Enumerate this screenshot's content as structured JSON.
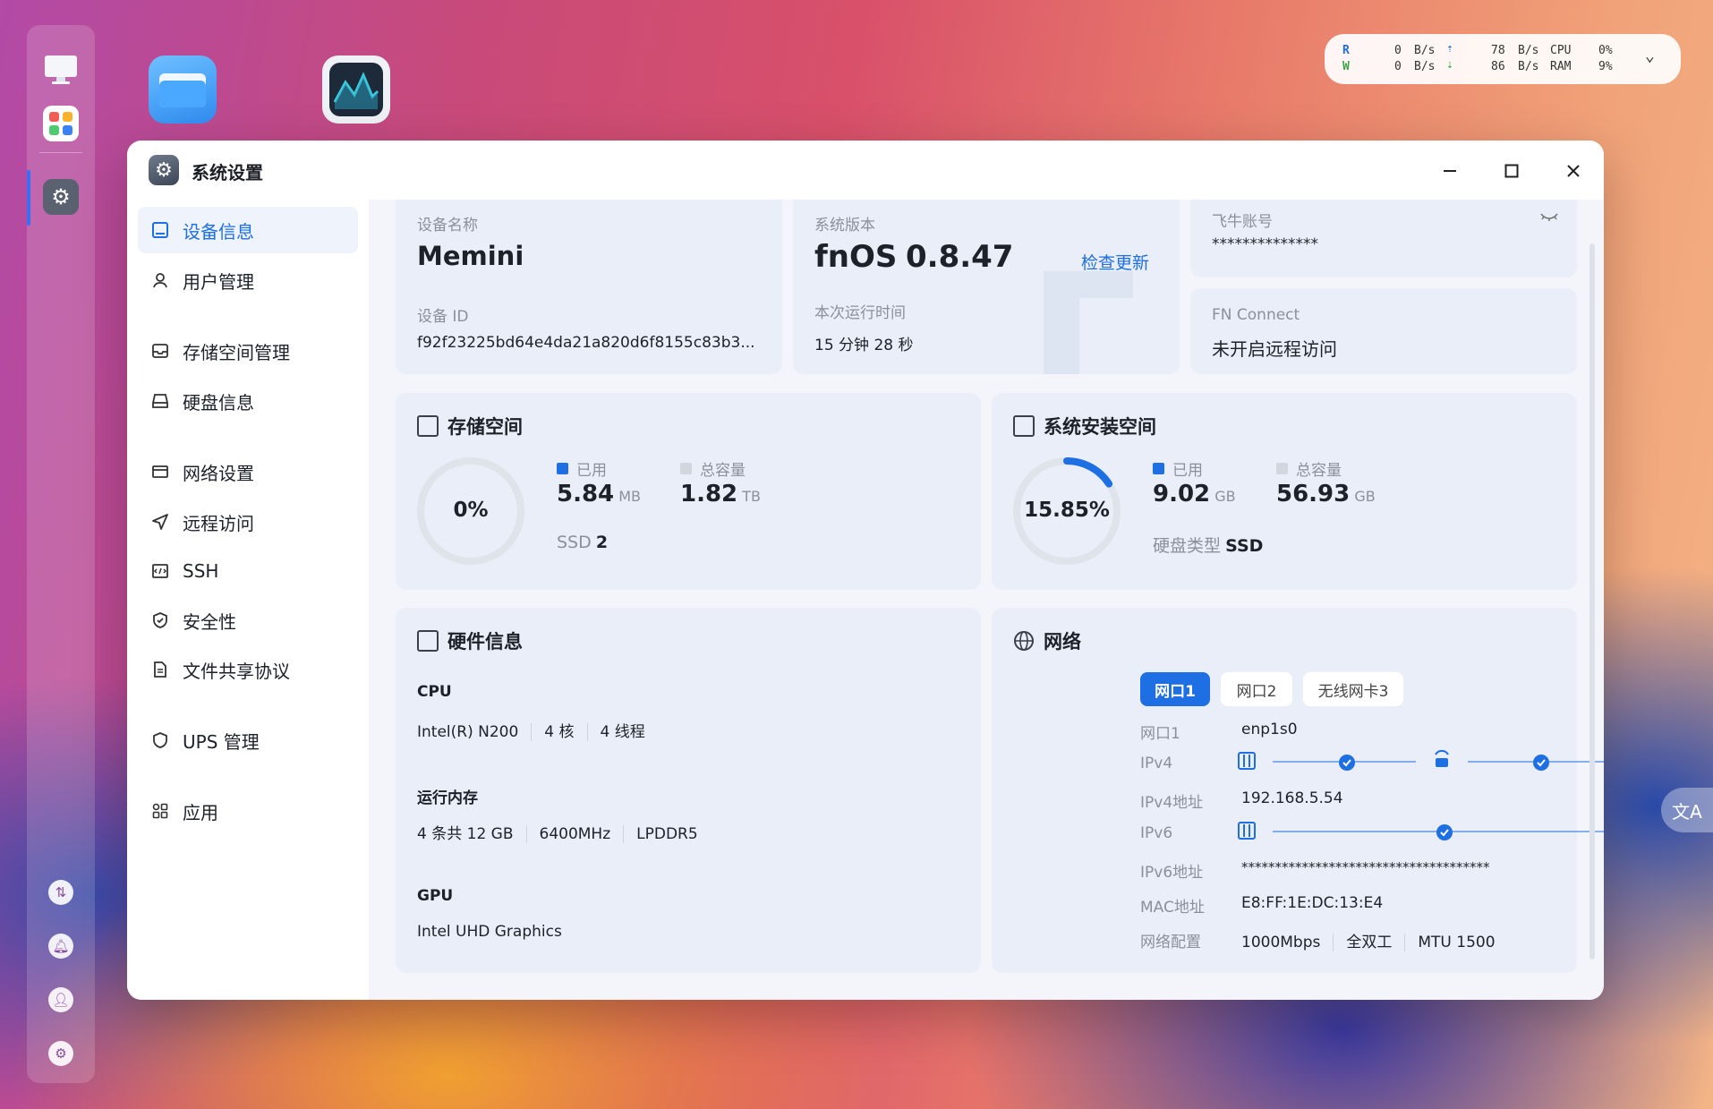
{
  "monitor": {
    "r_label": "R",
    "w_label": "W",
    "disk_read": "0",
    "disk_write": "0",
    "disk_unit_r": "B/s",
    "disk_unit_w": "B/s",
    "net_up": "78",
    "net_down": "86",
    "net_unit_up": "B/s",
    "net_unit_down": "B/s",
    "cpu_label": "CPU",
    "ram_label": "RAM",
    "cpu_value": "0%",
    "ram_value": "9%"
  },
  "window": {
    "title": "系统设置"
  },
  "sidebar": {
    "items": [
      {
        "label": "设备信息"
      },
      {
        "label": "用户管理"
      },
      {
        "label": "存储空间管理"
      },
      {
        "label": "硬盘信息"
      },
      {
        "label": "网络设置"
      },
      {
        "label": "远程访问"
      },
      {
        "label": "SSH"
      },
      {
        "label": "安全性"
      },
      {
        "label": "文件共享协议"
      },
      {
        "label": "UPS 管理"
      },
      {
        "label": "应用"
      }
    ]
  },
  "device": {
    "name_label": "设备名称",
    "name": "Memini",
    "id_label": "设备 ID",
    "id": "f92f23225bd64e4da21a820d6f8155c83b3..."
  },
  "system": {
    "version_label": "系统版本",
    "os_name": "fnOS",
    "version": "0.8.47",
    "check_update": "检查更新",
    "uptime_label": "本次运行时间",
    "uptime": "15 分钟 28 秒"
  },
  "account": {
    "label": "飞牛账号",
    "value": "**************"
  },
  "fnconnect": {
    "label": "FN Connect",
    "value": "未开启远程访问"
  },
  "storage": {
    "title": "存储空间",
    "percent": "0%",
    "percent_value": 0,
    "used_label": "已用",
    "used_value": "5.84",
    "used_unit": "MB",
    "total_label": "总容量",
    "total_value": "1.82",
    "total_unit": "TB",
    "type_label": "SSD",
    "type_count": "2"
  },
  "sysinstall": {
    "title": "系统安装空间",
    "percent": "15.85%",
    "percent_value": 15.85,
    "used_label": "已用",
    "used_value": "9.02",
    "used_unit": "GB",
    "total_label": "总容量",
    "total_value": "56.93",
    "total_unit": "GB",
    "disk_type_label": "硬盘类型",
    "disk_type": "SSD"
  },
  "hardware": {
    "title": "硬件信息",
    "cpu_label": "CPU",
    "cpu_model": "Intel(R) N200",
    "cpu_cores": "4 核",
    "cpu_threads": "4 线程",
    "mem_label": "运行内存",
    "mem_size": "4 条共 12 GB",
    "mem_freq": "6400MHz",
    "mem_type": "LPDDR5",
    "gpu_label": "GPU",
    "gpu_model": "Intel UHD Graphics"
  },
  "network": {
    "title": "网络",
    "tabs": [
      "网口1",
      "网口2",
      "无线网卡3"
    ],
    "port_label": "网口1",
    "port_value": "enp1s0",
    "ipv4_label": "IPv4",
    "ipv4_addr_label": "IPv4地址",
    "ipv4_addr": "192.168.5.54",
    "ipv6_label": "IPv6",
    "ipv6_addr_label": "IPv6地址",
    "ipv6_addr": "*************************************",
    "mac_label": "MAC地址",
    "mac": "E8:FF:1E:DC:13:E4",
    "config_label": "网络配置",
    "speed": "1000Mbps",
    "duplex": "全双工",
    "mtu": "MTU 1500"
  },
  "colors": {
    "accent": "#1e6fe3",
    "ring_track": "#dfe3ea",
    "legend_used": "#1e6fe3",
    "legend_total": "#d2d6de"
  }
}
